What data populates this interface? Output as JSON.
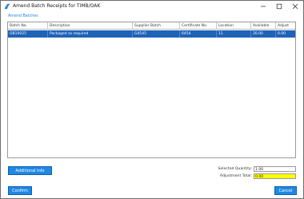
{
  "window": {
    "title": "Amend Batch Receipts for TIMB/OAK"
  },
  "section": {
    "label": "Amend Batches"
  },
  "grid": {
    "columns": [
      "Batch No.",
      "Description",
      "Supplier Batch",
      "Certificate No.",
      "Location",
      "Available",
      "Adjust"
    ],
    "rows": [
      [
        "OB10025",
        "Packaged as required",
        "G4545",
        "6454",
        "11",
        "20.00",
        "0.00"
      ]
    ]
  },
  "buttons": {
    "additional_info": "Additional Info",
    "confirm": "Confirm",
    "cancel": "Cancel"
  },
  "fields": {
    "selected_quantity_label": "Selected Quantity:",
    "selected_quantity_value": "1.00",
    "adjustment_total_label": "Adjustment Total:",
    "adjustment_total_value": "0.00"
  },
  "colors": {
    "accent": "#1e88e5",
    "selected_row": "#1d63b8",
    "highlight_field": "#ffff00"
  }
}
